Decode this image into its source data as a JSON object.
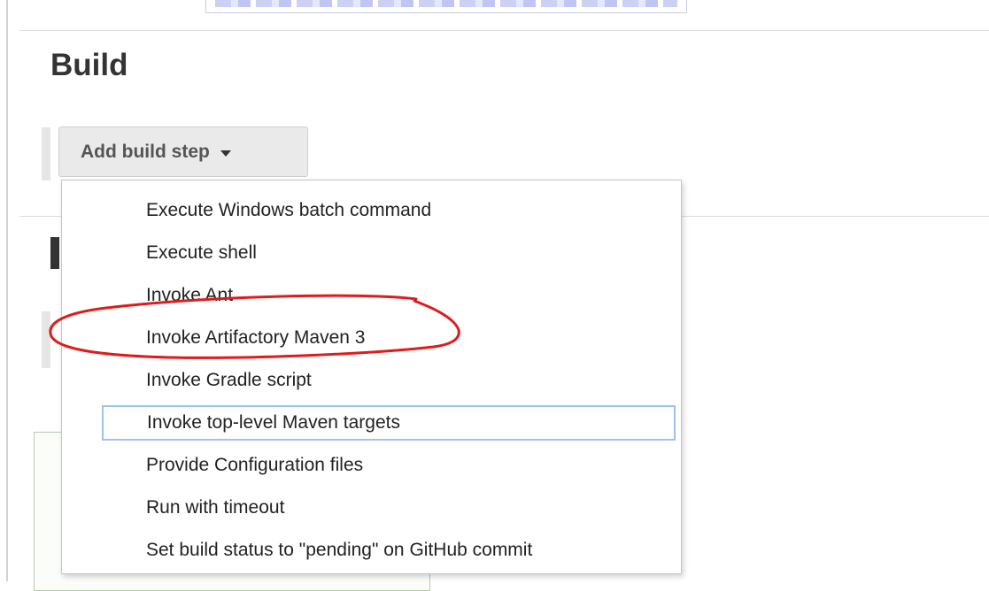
{
  "colors": {
    "annotation": "#e01b1b",
    "focus_outline": "#9ec1f3",
    "button_bg": "#eaeaea"
  },
  "section": {
    "title": "Build"
  },
  "add_step_button": {
    "label": "Add build step",
    "icon": "caret-down-icon"
  },
  "dropdown": {
    "items": [
      {
        "label": "Execute Windows batch command"
      },
      {
        "label": "Execute shell"
      },
      {
        "label": "Invoke Ant"
      },
      {
        "label": "Invoke Artifactory Maven 3"
      },
      {
        "label": "Invoke Gradle script"
      },
      {
        "label": "Invoke top-level Maven targets"
      },
      {
        "label": "Provide Configuration files"
      },
      {
        "label": "Run with timeout"
      },
      {
        "label": "Set build status to \"pending\" on GitHub commit"
      }
    ],
    "focused_index": 5,
    "annotated_index": 3
  }
}
